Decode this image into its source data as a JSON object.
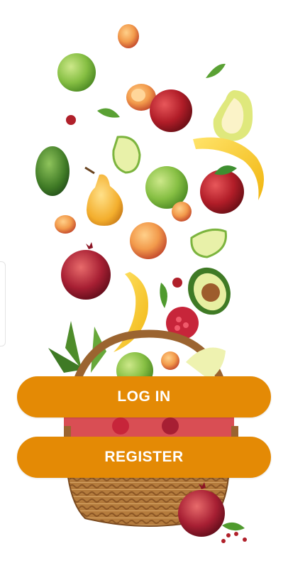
{
  "auth": {
    "login_label": "LOG IN",
    "register_label": "REGISTER"
  },
  "colors": {
    "accent": "#e48a05",
    "background": "#ffffff"
  },
  "illustration": {
    "icon": "fruit-basket-illustration"
  }
}
